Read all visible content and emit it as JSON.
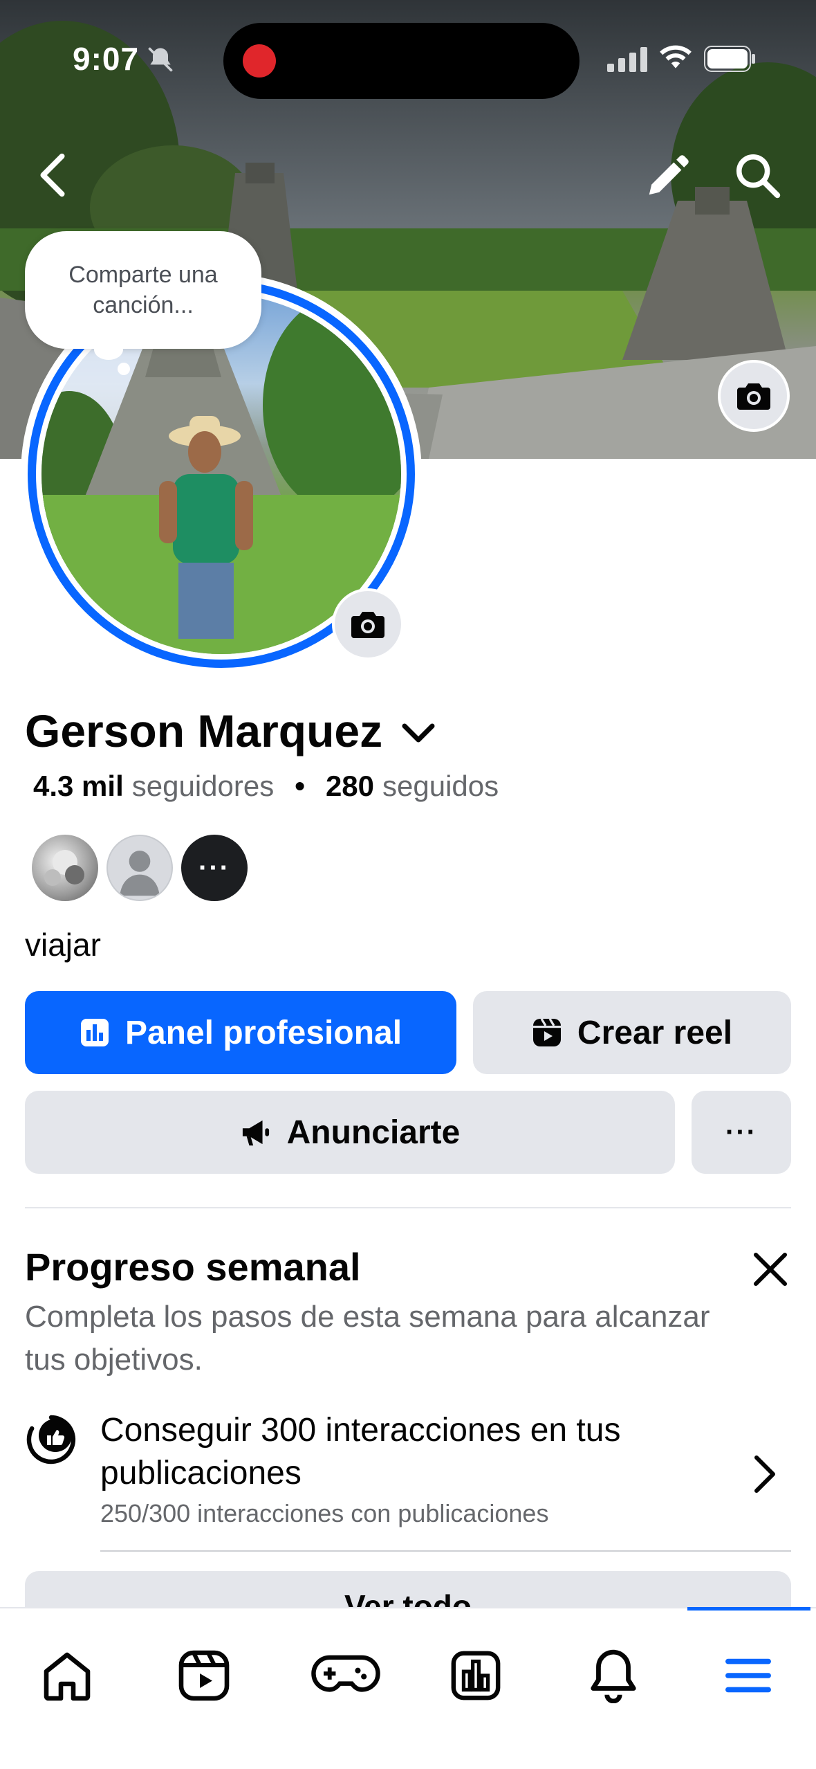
{
  "status": {
    "time": "9:07"
  },
  "profile": {
    "name": "Gerson Marquez",
    "followers_count": "4.3 mil",
    "followers_label": "seguidores",
    "following_count": "280",
    "following_label": "seguidos",
    "separator": "•",
    "bio": "viajar",
    "note_bubble": "Comparte una canción..."
  },
  "featured": {
    "more_label": "···"
  },
  "actions": {
    "professional_dashboard": "Panel profesional",
    "create_reel": "Crear reel",
    "advertise": "Anunciarte",
    "more": "···"
  },
  "weekly_progress": {
    "title": "Progreso semanal",
    "description": "Completa los pasos de esta semana para alcanzar tus objetivos.",
    "task_title": "Conseguir 300 interacciones en tus publicaciones",
    "task_progress": "250/300 interacciones con publicaciones",
    "task_value": 250,
    "task_goal": 300,
    "see_all": "Ver todo"
  },
  "colors": {
    "accent": "#0866ff",
    "button_gray": "#e4e6eb",
    "recording": "#e0262b"
  },
  "tabbar": {
    "items": [
      "home-icon",
      "reels-icon",
      "gaming-icon",
      "dashboard-icon",
      "notifications-icon",
      "menu-icon"
    ],
    "active": "menu-icon"
  }
}
